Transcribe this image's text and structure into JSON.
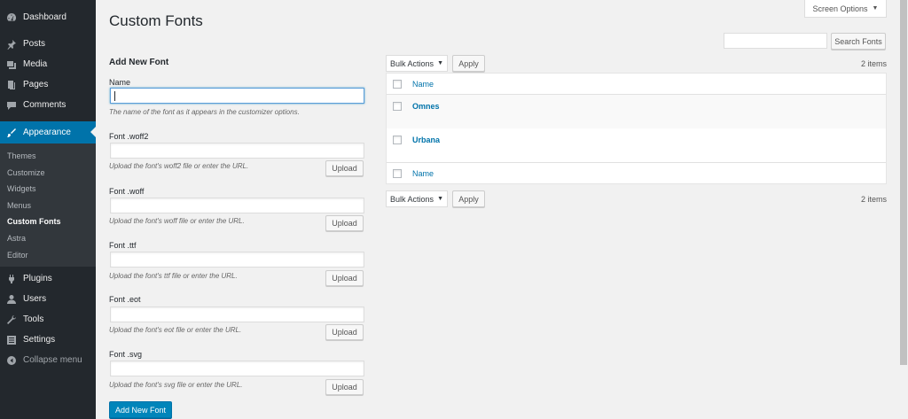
{
  "sidebar": {
    "items_top": [
      {
        "label": "Dashboard",
        "icon": "dashboard-icon"
      },
      {
        "label": "Posts",
        "icon": "pin-icon"
      },
      {
        "label": "Media",
        "icon": "media-icon"
      },
      {
        "label": "Pages",
        "icon": "pages-icon"
      },
      {
        "label": "Comments",
        "icon": "comments-icon"
      }
    ],
    "active": {
      "label": "Appearance",
      "icon": "paintbrush-icon"
    },
    "submenu": [
      "Themes",
      "Customize",
      "Widgets",
      "Menus",
      "Custom Fonts",
      "Astra",
      "Editor"
    ],
    "items_bottom": [
      {
        "label": "Plugins",
        "icon": "plugins-icon"
      },
      {
        "label": "Users",
        "icon": "users-icon"
      },
      {
        "label": "Tools",
        "icon": "tools-icon"
      },
      {
        "label": "Settings",
        "icon": "settings-icon"
      },
      {
        "label": "Collapse menu",
        "icon": "collapse-icon"
      }
    ]
  },
  "header": {
    "title": "Custom Fonts",
    "screen_options": "Screen Options",
    "search_button": "Search Fonts",
    "search_value": ""
  },
  "form": {
    "heading": "Add New Font",
    "name_label": "Name",
    "name_value": "",
    "name_desc": "The name of the font as it appears in the customizer options.",
    "fields": [
      {
        "label": "Font .woff2",
        "desc": "Upload the font's woff2 file or enter the URL.",
        "value": ""
      },
      {
        "label": "Font .woff",
        "desc": "Upload the font's woff file or enter the URL.",
        "value": ""
      },
      {
        "label": "Font .ttf",
        "desc": "Upload the font's ttf file or enter the URL.",
        "value": ""
      },
      {
        "label": "Font .eot",
        "desc": "Upload the font's eot file or enter the URL.",
        "value": ""
      },
      {
        "label": "Font .svg",
        "desc": "Upload the font's svg file or enter the URL.",
        "value": ""
      }
    ],
    "upload_label": "Upload",
    "submit_label": "Add New Font"
  },
  "table": {
    "bulk_actions": "Bulk Actions",
    "apply": "Apply",
    "count": "2 items",
    "column_name": "Name",
    "rows": [
      "Omnes",
      "Urbana"
    ]
  },
  "colors": {
    "sidebar_bg": "#23282d",
    "accent": "#0073aa",
    "primary_button": "#0085ba"
  }
}
